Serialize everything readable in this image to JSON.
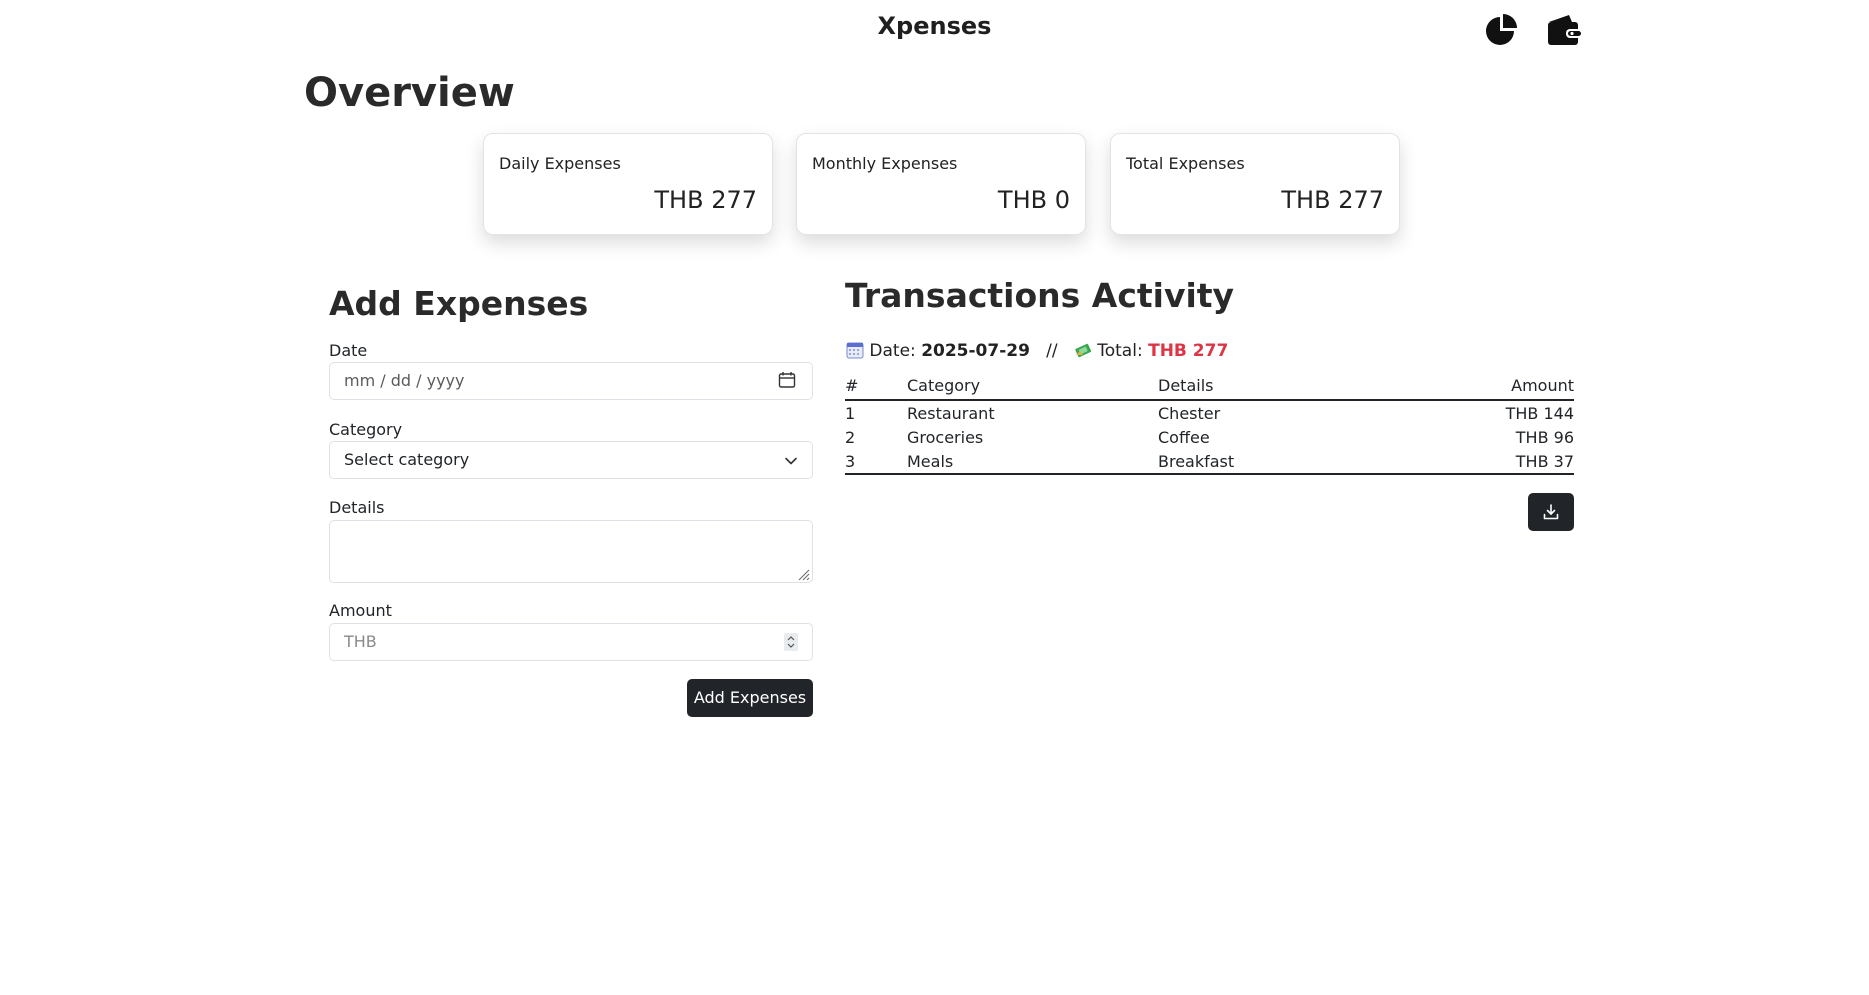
{
  "app": {
    "title": "Xpenses"
  },
  "nav": {
    "chart_icon": "pie-chart-icon",
    "wallet_icon": "wallet-icon"
  },
  "overview": {
    "title": "Overview",
    "cards": [
      {
        "label": "Daily Expenses",
        "value": "THB 277"
      },
      {
        "label": "Monthly Expenses",
        "value": "THB 0"
      },
      {
        "label": "Total Expenses",
        "value": "THB 277"
      }
    ]
  },
  "form": {
    "title": "Add Expenses",
    "date": {
      "label": "Date",
      "placeholder": "mm / dd / yyyy",
      "icon": "calendar-icon"
    },
    "category": {
      "label": "Category",
      "selected": "Select category",
      "icon": "chevron-down-icon"
    },
    "details": {
      "label": "Details",
      "value": ""
    },
    "amount": {
      "label": "Amount",
      "placeholder": "THB",
      "icon": "spinner-icon"
    },
    "submit_label": "Add Expenses"
  },
  "transactions": {
    "title": "Transactions Activity",
    "date_label": "Date:",
    "date_value": "2025-07-29",
    "separator": "//",
    "total_label": "Total:",
    "total_value": "THB 277",
    "total_color": "#dc3545",
    "columns": [
      "#",
      "Category",
      "Details",
      "Amount"
    ],
    "rows": [
      {
        "idx": "1",
        "category": "Restaurant",
        "details": "Chester",
        "amount": "THB 144"
      },
      {
        "idx": "2",
        "category": "Groceries",
        "details": "Coffee",
        "amount": "THB 96"
      },
      {
        "idx": "3",
        "category": "Meals",
        "details": "Breakfast",
        "amount": "THB 37"
      }
    ],
    "download_icon": "download-icon"
  }
}
